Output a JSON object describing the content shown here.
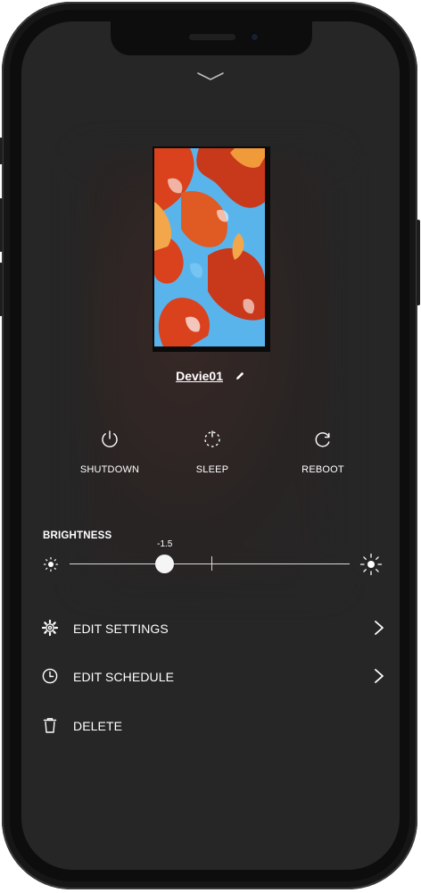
{
  "device": {
    "name": "Devie01"
  },
  "actions": [
    {
      "label": "SHUTDOWN",
      "icon": "power-icon"
    },
    {
      "label": "SLEEP",
      "icon": "sleep-icon"
    },
    {
      "label": "REBOOT",
      "icon": "reboot-icon"
    }
  ],
  "brightness": {
    "label": "BRIGHTNESS",
    "value": "-1.5",
    "level_fraction": 0.34
  },
  "menu": [
    {
      "label": "EDIT SETTINGS",
      "icon": "gear-icon",
      "has_chevron": true
    },
    {
      "label": "EDIT SCHEDULE",
      "icon": "clock-icon",
      "has_chevron": true
    },
    {
      "label": "DELETE",
      "icon": "trash-icon",
      "has_chevron": false
    }
  ],
  "colors": {
    "background": "#262626",
    "foreground": "#ffffff",
    "artwork_orange": "#d9421c",
    "artwork_blue": "#5ab4ec"
  }
}
